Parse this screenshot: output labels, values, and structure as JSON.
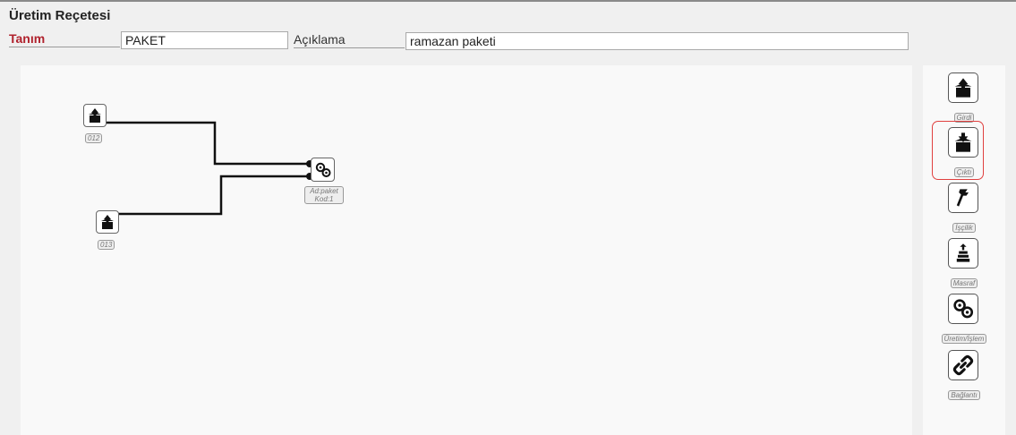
{
  "header": {
    "title": "Üretim Reçetesi",
    "tanim_label": "Tanım",
    "tanim_value": "PAKET",
    "aciklama_label": "Açıklama",
    "aciklama_value": "ramazan paketi"
  },
  "canvas": {
    "nodes": [
      {
        "label": "012",
        "icon": "box-up-icon"
      },
      {
        "label": "013",
        "icon": "box-up-icon"
      },
      {
        "label_line1": "Ad:paket",
        "label_line2": "Kod:1",
        "icon": "gears-icon"
      }
    ]
  },
  "toolbar": {
    "items": [
      {
        "label": "Girdi",
        "icon": "box-up-icon"
      },
      {
        "label": "Çıktı",
        "icon": "box-down-icon",
        "selected": true
      },
      {
        "label": "İşçilik",
        "icon": "wrench-icon"
      },
      {
        "label": "Masraf",
        "icon": "coins-icon"
      },
      {
        "label": "Üretim/İşlem",
        "icon": "gears-icon"
      },
      {
        "label": "Bağlantı",
        "icon": "link-icon"
      }
    ],
    "highlight_color": "#e0403f"
  },
  "colors": {
    "accent_label": "#b0222d"
  }
}
